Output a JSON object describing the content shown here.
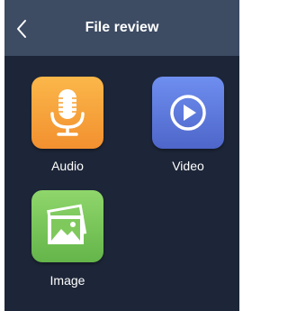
{
  "header": {
    "title": "File review",
    "back_icon": "chevron-left-icon"
  },
  "items": [
    {
      "label": "Audio",
      "icon": "microphone-icon",
      "color_top": "#fbb74a",
      "color_bottom": "#f2902f"
    },
    {
      "label": "Video",
      "icon": "play-icon",
      "color_top": "#6e8ef0",
      "color_bottom": "#4e66c9"
    },
    {
      "label": "Image",
      "icon": "image-icon",
      "color_top": "#8fd66b",
      "color_bottom": "#64b54a"
    }
  ],
  "colors": {
    "header_bg": "#3d4b63",
    "content_bg": "#1d2638"
  }
}
